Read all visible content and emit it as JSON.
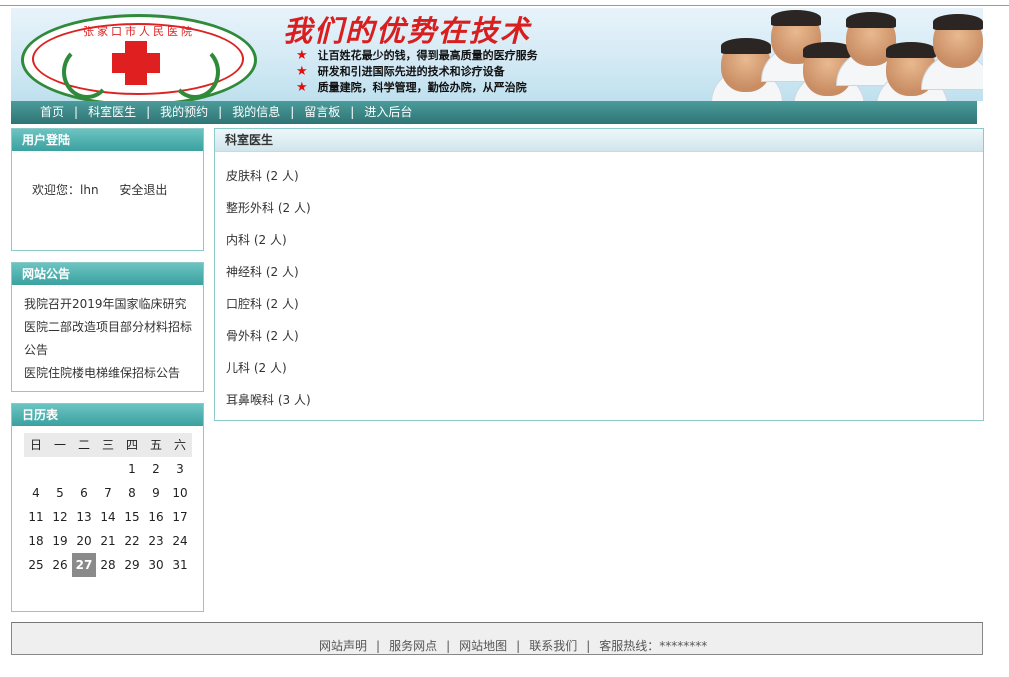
{
  "banner": {
    "logo_text": "张家口市人民医院",
    "slogan": "我们的优势在技术",
    "points": [
      "让百姓花最少的钱，得到最高质量的医疗服务",
      "研发和引进国际先进的技术和诊疗设备",
      "质量建院，科学管理，勤俭办院，从严治院"
    ],
    "colors": {
      "slogan": "#d81e1e",
      "logo_ring": "#2f8a3a",
      "cross": "#e02020"
    }
  },
  "nav": {
    "items": [
      "首页",
      "科室医生",
      "我的预约",
      "我的信息",
      "留言板",
      "进入后台"
    ],
    "separator": "|",
    "color": "#2f7475"
  },
  "login": {
    "title": "用户登陆",
    "welcome": "欢迎您：lhn",
    "logout": "安全退出"
  },
  "notice": {
    "title": "网站公告",
    "items": [
      "我院召开2019年国家临床研究",
      "医院二部改造项目部分材料招标公告",
      "医院住院楼电梯维保招标公告"
    ]
  },
  "calendar": {
    "title": "日历表",
    "weekdays": [
      "日",
      "一",
      "二",
      "三",
      "四",
      "五",
      "六"
    ],
    "weeks": [
      [
        "",
        "",
        "",
        "",
        "1",
        "2",
        "3"
      ],
      [
        "4",
        "5",
        "6",
        "7",
        "8",
        "9",
        "10"
      ],
      [
        "11",
        "12",
        "13",
        "14",
        "15",
        "16",
        "17"
      ],
      [
        "18",
        "19",
        "20",
        "21",
        "22",
        "23",
        "24"
      ],
      [
        "25",
        "26",
        "27",
        "28",
        "29",
        "30",
        "31"
      ]
    ],
    "today": "27"
  },
  "departments": {
    "title": "科室医生",
    "items": [
      "皮肤科 (2 人)",
      "整形外科 (2 人)",
      "内科 (2 人)",
      "神经科 (2 人)",
      "口腔科 (2 人)",
      "骨外科 (2 人)",
      "儿科 (2 人)",
      "耳鼻喉科 (3 人)"
    ]
  },
  "footer": {
    "links": [
      "网站声明",
      "服务网点",
      "网站地图",
      "联系我们"
    ],
    "separator": "|",
    "hotline": "客服热线：********"
  }
}
